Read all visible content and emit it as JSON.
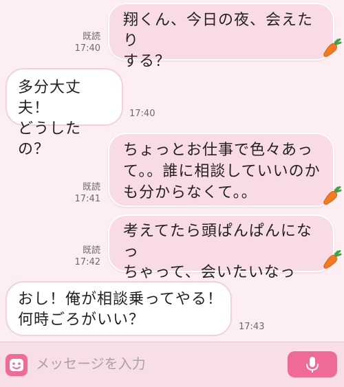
{
  "messages": [
    {
      "side": "sent",
      "text": "翔くん、今日の夜、会えたり\nする？",
      "read": "既読",
      "time": "17:40"
    },
    {
      "side": "recv",
      "text": "多分大丈夫！\nどうしたの？",
      "time": "17:40"
    },
    {
      "side": "sent",
      "text": "ちょっとお仕事で色々あっ\nて。。誰に相談していいのか\nも分からなくて。。",
      "read": "既読",
      "time": "17:41"
    },
    {
      "side": "sent",
      "text": "考えてたら頭ぱんぱんになっ\nちゃって、会いたいなって。",
      "read": "既読",
      "time": "17:42"
    },
    {
      "side": "recv",
      "text": "おし！俺が相談乗ってやる！\n何時ごろがいい？",
      "time": "17:43"
    }
  ],
  "input": {
    "placeholder": "メッセージを入力"
  },
  "icons": {
    "emoji": "emoji-face-icon",
    "mic": "microphone-icon",
    "sticker": "carrot-icon"
  },
  "colors": {
    "background": "#fdeef3",
    "sent_bubble": "#f8dbe5",
    "received_bubble": "#ffffff",
    "accent": "#f06a98"
  }
}
